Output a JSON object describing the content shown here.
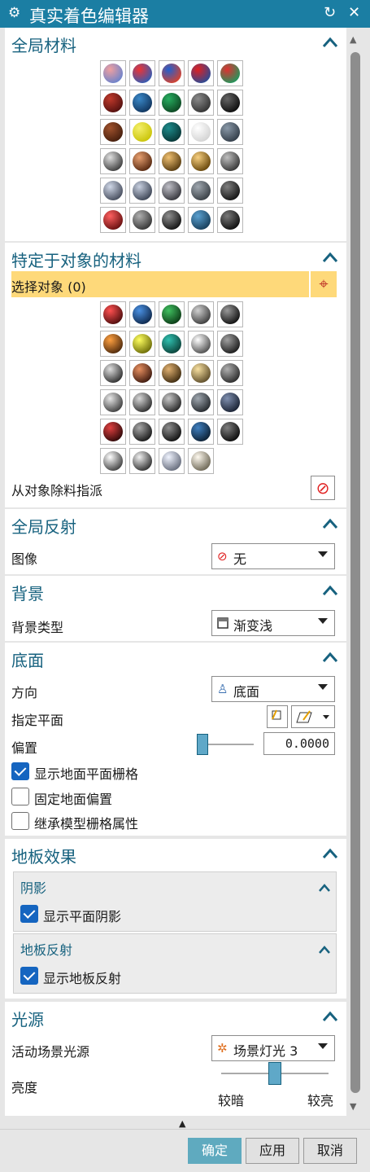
{
  "window": {
    "title": "真实着色编辑器",
    "title_icon": "gear-icon",
    "reset_icon": "reset-icon",
    "close_icon": "close-icon"
  },
  "collapse_glyph": "^",
  "sections": {
    "global_materials": {
      "title": "全局材料",
      "grid": [
        [
          {
            "name": "mat-multicolor-1",
            "c": [
              "#f0a0a0",
              "#6080d0"
            ]
          },
          {
            "name": "mat-multicolor-2",
            "c": [
              "#e33",
              "#2260c0"
            ]
          },
          {
            "name": "mat-multicolor-3",
            "c": [
              "#2060d0",
              "#e64020"
            ]
          },
          {
            "name": "mat-multicolor-4",
            "c": [
              "#e02020",
              "#1b4fa0"
            ]
          },
          {
            "name": "mat-multicolor-5",
            "c": [
              "#e03030",
              "#10a060"
            ]
          }
        ],
        [
          {
            "name": "mat-dark-red",
            "c": [
              "#c0392b",
              "#4a0d0d"
            ]
          },
          {
            "name": "mat-blue",
            "c": [
              "#3a88c8",
              "#0d2e55"
            ]
          },
          {
            "name": "mat-green",
            "c": [
              "#27ae60",
              "#0b3d1d"
            ]
          },
          {
            "name": "mat-gray",
            "c": [
              "#8a8a8a",
              "#2c2c2c"
            ]
          },
          {
            "name": "mat-black",
            "c": [
              "#666",
              "#050505"
            ]
          }
        ],
        [
          {
            "name": "mat-brown",
            "c": [
              "#a0522d",
              "#3d1a0a"
            ]
          },
          {
            "name": "mat-yellow",
            "c": [
              "#f4ef6a",
              "#c6c000"
            ]
          },
          {
            "name": "mat-teal",
            "c": [
              "#1e8c8c",
              "#062e2e"
            ]
          },
          {
            "name": "mat-white",
            "c": [
              "#ffffff",
              "#cfcfcf"
            ]
          },
          {
            "name": "mat-slate",
            "c": [
              "#8a99a8",
              "#2b3540"
            ]
          }
        ],
        [
          {
            "name": "mat-steel",
            "c": [
              "#e0e0e0",
              "#303030"
            ]
          },
          {
            "name": "mat-copper",
            "c": [
              "#e8a070",
              "#4a1e08"
            ]
          },
          {
            "name": "mat-brass",
            "c": [
              "#f0c070",
              "#4a3008"
            ]
          },
          {
            "name": "mat-gold",
            "c": [
              "#f8d080",
              "#5a3a00"
            ]
          },
          {
            "name": "mat-dark-steel",
            "c": [
              "#c0c0c0",
              "#2a2a2a"
            ]
          }
        ],
        [
          {
            "name": "mat-brushed-1",
            "c": [
              "#d0d8e8",
              "#3a4050"
            ]
          },
          {
            "name": "mat-brushed-2",
            "c": [
              "#c8d0e0",
              "#303848"
            ]
          },
          {
            "name": "mat-brushed-3",
            "c": [
              "#c0c0c8",
              "#2a2a30"
            ]
          },
          {
            "name": "mat-rough",
            "c": [
              "#a0a8b0",
              "#30363c"
            ]
          },
          {
            "name": "mat-black-gloss",
            "c": [
              "#808080",
              "#0a0a0a"
            ]
          }
        ],
        [
          {
            "name": "mat-red-gloss",
            "c": [
              "#ff6060",
              "#5a0808"
            ]
          },
          {
            "name": "mat-gray-gloss",
            "c": [
              "#b0b0b0",
              "#2a2a2a"
            ]
          },
          {
            "name": "mat-black-2",
            "c": [
              "#909090",
              "#080808"
            ]
          },
          {
            "name": "mat-blue-2",
            "c": [
              "#5aa0d0",
              "#123650"
            ]
          },
          {
            "name": "mat-black-3",
            "c": [
              "#7a7a7a",
              "#050505"
            ]
          }
        ]
      ]
    },
    "object_materials": {
      "title": "特定于对象的材料",
      "select_label": "选择对象 (0)",
      "select_icon": "crosshair-icon",
      "grid": [
        [
          {
            "name": "obj-red",
            "c": [
              "#ff5050",
              "#400808"
            ]
          },
          {
            "name": "obj-blue",
            "c": [
              "#4a90e2",
              "#0a2040"
            ]
          },
          {
            "name": "obj-green",
            "c": [
              "#40c060",
              "#083010"
            ]
          },
          {
            "name": "obj-gray",
            "c": [
              "#d0d0d0",
              "#303030"
            ]
          },
          {
            "name": "obj-black",
            "c": [
              "#999",
              "#050505"
            ]
          }
        ],
        [
          {
            "name": "obj-orange",
            "c": [
              "#ffa040",
              "#402008"
            ]
          },
          {
            "name": "obj-yellow",
            "c": [
              "#ffff60",
              "#606000"
            ]
          },
          {
            "name": "obj-teal",
            "c": [
              "#30c0b0",
              "#083830"
            ]
          },
          {
            "name": "obj-silver",
            "c": [
              "#ffffff",
              "#404040"
            ]
          },
          {
            "name": "obj-dark",
            "c": [
              "#a0a0a0",
              "#101010"
            ]
          }
        ],
        [
          {
            "name": "obj-steel",
            "c": [
              "#e0e0e0",
              "#202020"
            ]
          },
          {
            "name": "obj-copper",
            "c": [
              "#e89060",
              "#301008"
            ]
          },
          {
            "name": "obj-bronze",
            "c": [
              "#e0b070",
              "#302008"
            ]
          },
          {
            "name": "obj-gold",
            "c": [
              "#f8e0a0",
              "#504020"
            ]
          },
          {
            "name": "obj-gray-2",
            "c": [
              "#b0b0b0",
              "#202020"
            ]
          }
        ],
        [
          {
            "name": "obj-brushed-1",
            "c": [
              "#e8e8e8",
              "#303030"
            ]
          },
          {
            "name": "obj-brushed-2",
            "c": [
              "#d8d8d8",
              "#202020"
            ]
          },
          {
            "name": "obj-brushed-3",
            "c": [
              "#c8c8c8",
              "#181818"
            ]
          },
          {
            "name": "obj-rough",
            "c": [
              "#a0a8b0",
              "#1a1e22"
            ]
          },
          {
            "name": "obj-blue-dark",
            "c": [
              "#8090b0",
              "#101828"
            ]
          }
        ],
        [
          {
            "name": "obj-red-dark",
            "c": [
              "#e04040",
              "#200404"
            ]
          },
          {
            "name": "obj-graphite",
            "c": [
              "#a8a8a8",
              "#0c0c0c"
            ]
          },
          {
            "name": "obj-black-2",
            "c": [
              "#909090",
              "#050505"
            ]
          },
          {
            "name": "obj-navy",
            "c": [
              "#4080c0",
              "#081828"
            ]
          },
          {
            "name": "obj-black-3",
            "c": [
              "#808080",
              "#000000"
            ]
          }
        ],
        [
          {
            "name": "obj-chrome",
            "c": [
              "#ffffff",
              "#303030"
            ]
          },
          {
            "name": "obj-chrome-2",
            "c": [
              "#f0f0f0",
              "#202020"
            ]
          },
          {
            "name": "obj-pearl",
            "c": [
              "#f0f4ff",
              "#5a6070"
            ]
          },
          {
            "name": "obj-champagne",
            "c": [
              "#fffaf0",
              "#605a48"
            ]
          }
        ]
      ],
      "remove_label": "从对象除料指派",
      "remove_icon": "no-entry-icon"
    },
    "global_reflection": {
      "title": "全局反射",
      "image_label": "图像",
      "image_value": "无",
      "image_icon": "no-entry-icon"
    },
    "background": {
      "title": "背景",
      "type_label": "背景类型",
      "type_value": "渐变浅",
      "type_icon": "square-icon"
    },
    "floor": {
      "title": "底面",
      "direction_label": "方向",
      "direction_value": "底面",
      "direction_icon": "floor-icon",
      "plane_label": "指定平面",
      "offset_label": "偏置",
      "offset_value": "0.0000",
      "offset_slider_level": 0,
      "cb_show_grid": {
        "label": "显示地面平面栅格",
        "checked": true
      },
      "cb_fixed_offset": {
        "label": "固定地面偏置",
        "checked": false
      },
      "cb_inherit_grid": {
        "label": "继承模型栅格属性",
        "checked": false
      }
    },
    "floor_effects": {
      "title": "地板效果",
      "shadow": {
        "title": "阴影",
        "cb_label": "显示平面阴影",
        "checked": true
      },
      "reflection": {
        "title": "地板反射",
        "cb_label": "显示地板反射",
        "checked": true
      }
    },
    "lights": {
      "title": "光源",
      "active_label": "活动场景光源",
      "active_value": "场景灯光 3",
      "active_icon": "lights-icon",
      "brightness_label": "亮度",
      "brightness_level": 0.5,
      "darker": "较暗",
      "brighter": "较亮"
    }
  },
  "footer": {
    "ok": "确定",
    "apply": "应用",
    "cancel": "取消",
    "collapse_arrow": "▲"
  }
}
